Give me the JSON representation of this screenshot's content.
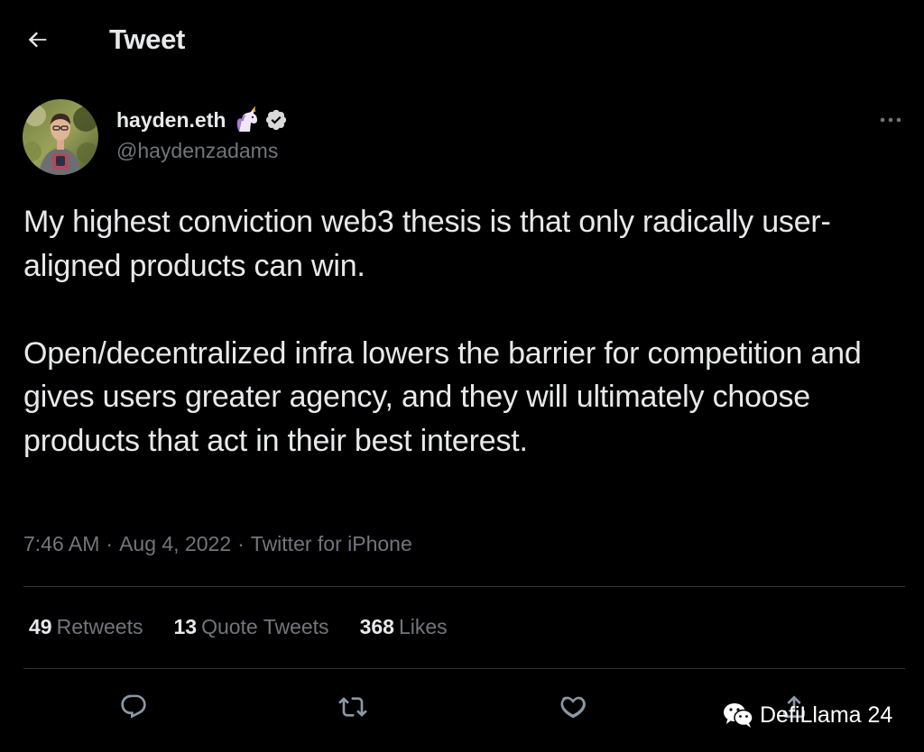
{
  "header": {
    "title": "Tweet",
    "back_icon": "arrow-left-icon"
  },
  "author": {
    "display_name": "hayden.eth",
    "emoji": "unicorn-emoji",
    "verified": true,
    "handle": "@haydenzadams"
  },
  "tweet": {
    "paragraphs": [
      "My highest conviction web3 thesis is that only radically user-aligned products can win.",
      "Open/decentralized infra lowers the barrier for competition and gives users greater agency, and they will ultimately choose products that act in their best interest."
    ],
    "time": "7:46 AM",
    "date": "Aug 4, 2022",
    "source": "Twitter for iPhone",
    "separator": "·"
  },
  "stats": [
    {
      "count": "49",
      "label": "Retweets"
    },
    {
      "count": "13",
      "label": "Quote Tweets"
    },
    {
      "count": "368",
      "label": "Likes"
    }
  ],
  "actions": [
    "reply-icon",
    "retweet-icon",
    "like-icon",
    "share-icon"
  ],
  "watermark": {
    "text": "DefiLlama 24",
    "icon": "wechat-icon"
  },
  "colors": {
    "background": "#000000",
    "text_primary": "#e7e9ea",
    "text_secondary": "#71767b",
    "divider": "#2f3336",
    "verified_badge": "#d9d9d9"
  }
}
